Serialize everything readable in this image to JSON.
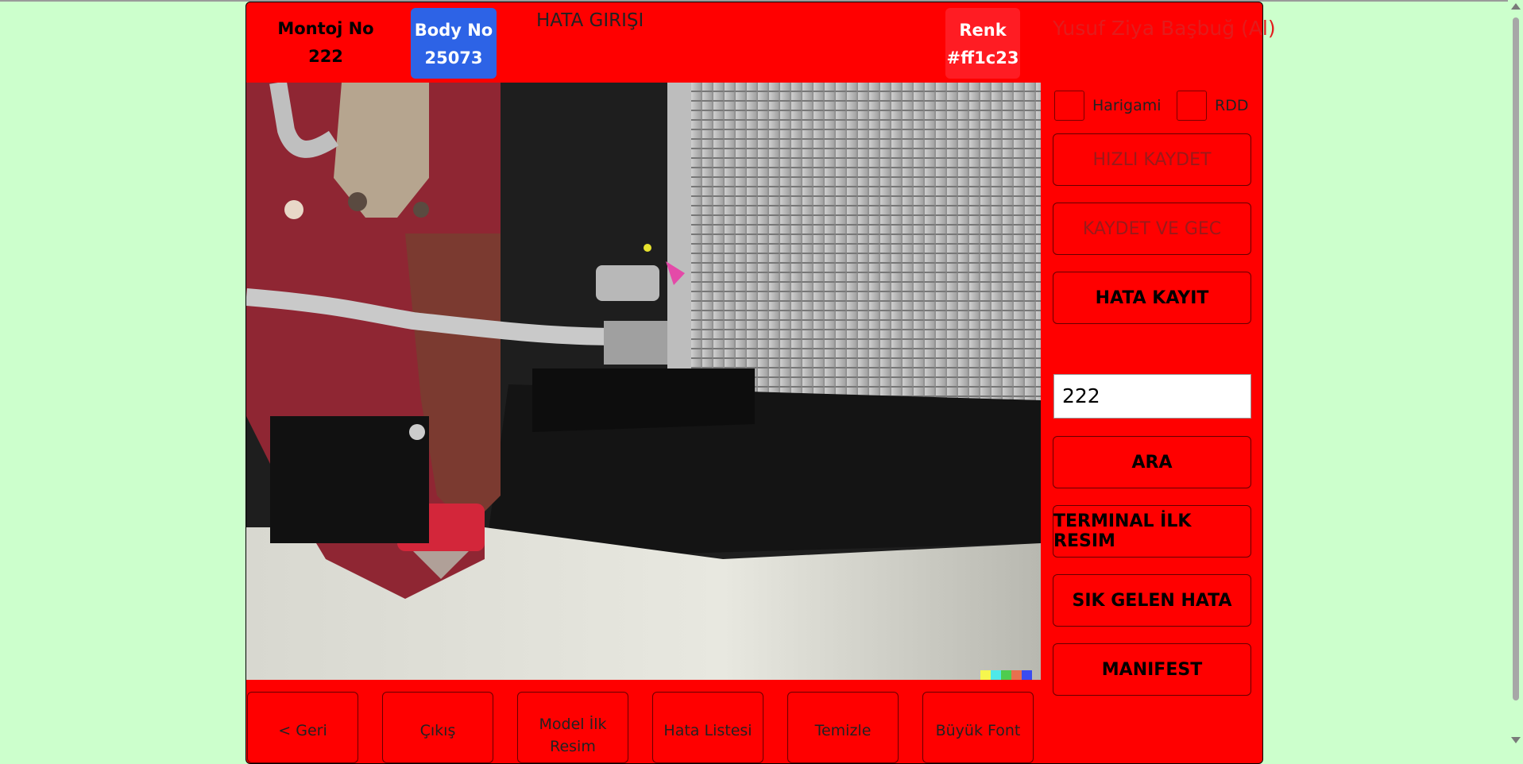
{
  "header": {
    "montaj_label": "Montoj No",
    "montaj_value": "222",
    "body_label": "Body No",
    "body_value": "25073",
    "title": "HATA GIRIŞI",
    "renk_label": "Renk",
    "renk_value": "#ff1c23",
    "user": "Yusuf Ziya Başbuğ (Al)"
  },
  "checkboxes": [
    {
      "label": "Harigami",
      "checked": false
    },
    {
      "label": "RDD",
      "checked": false
    }
  ],
  "side_buttons": {
    "hizli_kaydet": "HIZLI KAYDET",
    "kaydet_ve_gec": "KAYDET VE GEC",
    "hata_kayit": "HATA KAYIT",
    "ara": "ARA",
    "terminal_ilk_resim": "TERMINAL İLK RESIM",
    "sik_gelen_hata": "SIK GELEN HATA",
    "manifest": "MANIFEST"
  },
  "search": {
    "value": "222"
  },
  "bottom_buttons": {
    "geri": "< Geri",
    "cikis": "Çıkış",
    "model_ilk_resim_1": "Model İlk",
    "model_ilk_resim_2": "Resim",
    "hata_listesi": "Hata Listesi",
    "temizle": "Temizle",
    "buyuk_font": "Büyük Font"
  },
  "colors": {
    "panel_bg": "#ff0000",
    "page_bg": "#ccffcc",
    "body_badge": "#2d63e6",
    "renk_badge": "#ff1c23"
  }
}
